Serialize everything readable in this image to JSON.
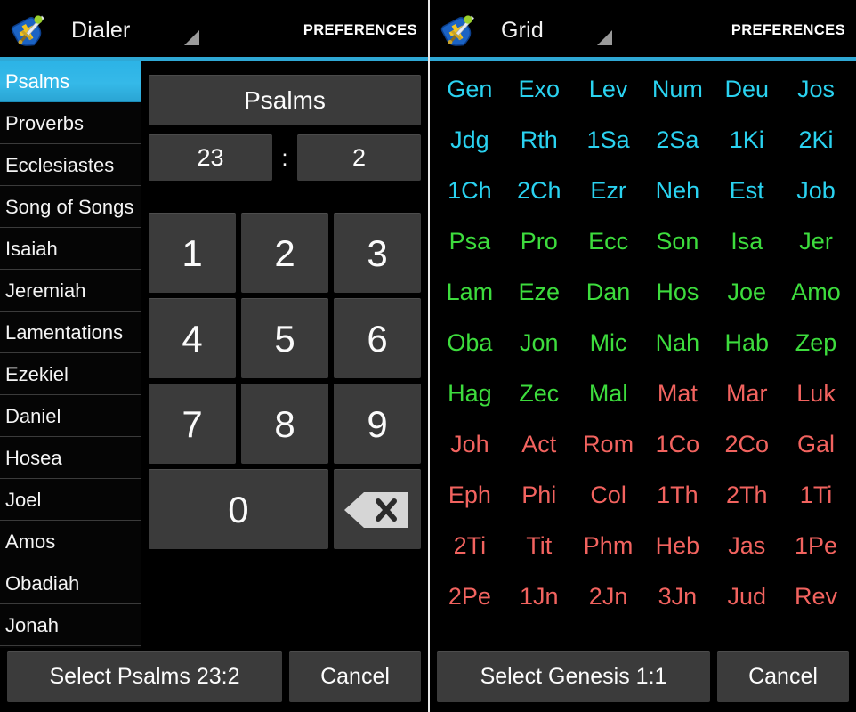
{
  "left": {
    "actionbar": {
      "icon": "shield-sword-app-icon",
      "title": "Dialer",
      "spinner": "dropdown-triangle-icon",
      "preferences": "PREFERENCES"
    },
    "books": [
      {
        "label": "Psalms",
        "selected": true
      },
      {
        "label": "Proverbs",
        "selected": false
      },
      {
        "label": "Ecclesiastes",
        "selected": false
      },
      {
        "label": "Song of Songs",
        "selected": false
      },
      {
        "label": "Isaiah",
        "selected": false
      },
      {
        "label": "Jeremiah",
        "selected": false
      },
      {
        "label": "Lamentations",
        "selected": false
      },
      {
        "label": "Ezekiel",
        "selected": false
      },
      {
        "label": "Daniel",
        "selected": false
      },
      {
        "label": "Hosea",
        "selected": false
      },
      {
        "label": "Joel",
        "selected": false
      },
      {
        "label": "Amos",
        "selected": false
      },
      {
        "label": "Obadiah",
        "selected": false
      },
      {
        "label": "Jonah",
        "selected": false
      }
    ],
    "readout": {
      "book": "Psalms",
      "chapter": "23",
      "separator": ":",
      "verse": "2"
    },
    "keypad": {
      "rows": [
        [
          "1",
          "2",
          "3"
        ],
        [
          "4",
          "5",
          "6"
        ],
        [
          "7",
          "8",
          "9"
        ]
      ],
      "zero": "0",
      "backspace_icon": "backspace-icon"
    },
    "footer": {
      "select": "Select Psalms 23:2",
      "cancel": "Cancel"
    }
  },
  "right": {
    "actionbar": {
      "icon": "shield-sword-app-icon",
      "title": "Grid",
      "spinner": "dropdown-triangle-icon",
      "preferences": "PREFERENCES"
    },
    "grid": {
      "columns": 6,
      "rows": [
        [
          {
            "t": "Gen",
            "c": "#2ad2f0"
          },
          {
            "t": "Exo",
            "c": "#2ad2f0"
          },
          {
            "t": "Lev",
            "c": "#2ad2f0"
          },
          {
            "t": "Num",
            "c": "#2ad2f0"
          },
          {
            "t": "Deu",
            "c": "#2ad2f0"
          },
          {
            "t": "Jos",
            "c": "#2ad2f0"
          }
        ],
        [
          {
            "t": "Jdg",
            "c": "#2ad2f0"
          },
          {
            "t": "Rth",
            "c": "#2ad2f0"
          },
          {
            "t": "1Sa",
            "c": "#2ad2f0"
          },
          {
            "t": "2Sa",
            "c": "#2ad2f0"
          },
          {
            "t": "1Ki",
            "c": "#2ad2f0"
          },
          {
            "t": "2Ki",
            "c": "#2ad2f0"
          }
        ],
        [
          {
            "t": "1Ch",
            "c": "#2ad2f0"
          },
          {
            "t": "2Ch",
            "c": "#2ad2f0"
          },
          {
            "t": "Ezr",
            "c": "#2ad2f0"
          },
          {
            "t": "Neh",
            "c": "#2ad2f0"
          },
          {
            "t": "Est",
            "c": "#2ad2f0"
          },
          {
            "t": "Job",
            "c": "#2ad2f0"
          }
        ],
        [
          {
            "t": "Psa",
            "c": "#3ddc3d"
          },
          {
            "t": "Pro",
            "c": "#3ddc3d"
          },
          {
            "t": "Ecc",
            "c": "#3ddc3d"
          },
          {
            "t": "Son",
            "c": "#3ddc3d"
          },
          {
            "t": "Isa",
            "c": "#3ddc3d"
          },
          {
            "t": "Jer",
            "c": "#3ddc3d"
          }
        ],
        [
          {
            "t": "Lam",
            "c": "#3ddc3d"
          },
          {
            "t": "Eze",
            "c": "#3ddc3d"
          },
          {
            "t": "Dan",
            "c": "#3ddc3d"
          },
          {
            "t": "Hos",
            "c": "#3ddc3d"
          },
          {
            "t": "Joe",
            "c": "#3ddc3d"
          },
          {
            "t": "Amo",
            "c": "#3ddc3d"
          }
        ],
        [
          {
            "t": "Oba",
            "c": "#3ddc3d"
          },
          {
            "t": "Jon",
            "c": "#3ddc3d"
          },
          {
            "t": "Mic",
            "c": "#3ddc3d"
          },
          {
            "t": "Nah",
            "c": "#3ddc3d"
          },
          {
            "t": "Hab",
            "c": "#3ddc3d"
          },
          {
            "t": "Zep",
            "c": "#3ddc3d"
          }
        ],
        [
          {
            "t": "Hag",
            "c": "#3ddc3d"
          },
          {
            "t": "Zec",
            "c": "#3ddc3d"
          },
          {
            "t": "Mal",
            "c": "#3ddc3d"
          },
          {
            "t": "Mat",
            "c": "#f2635f"
          },
          {
            "t": "Mar",
            "c": "#f2635f"
          },
          {
            "t": "Luk",
            "c": "#f2635f"
          }
        ],
        [
          {
            "t": "Joh",
            "c": "#f2635f"
          },
          {
            "t": "Act",
            "c": "#f2635f"
          },
          {
            "t": "Rom",
            "c": "#f2635f"
          },
          {
            "t": "1Co",
            "c": "#f2635f"
          },
          {
            "t": "2Co",
            "c": "#f2635f"
          },
          {
            "t": "Gal",
            "c": "#f2635f"
          }
        ],
        [
          {
            "t": "Eph",
            "c": "#f2635f"
          },
          {
            "t": "Phi",
            "c": "#f2635f"
          },
          {
            "t": "Col",
            "c": "#f2635f"
          },
          {
            "t": "1Th",
            "c": "#f2635f"
          },
          {
            "t": "2Th",
            "c": "#f2635f"
          },
          {
            "t": "1Ti",
            "c": "#f2635f"
          }
        ],
        [
          {
            "t": "2Ti",
            "c": "#f2635f"
          },
          {
            "t": "Tit",
            "c": "#f2635f"
          },
          {
            "t": "Phm",
            "c": "#f2635f"
          },
          {
            "t": "Heb",
            "c": "#f2635f"
          },
          {
            "t": "Jas",
            "c": "#f2635f"
          },
          {
            "t": "1Pe",
            "c": "#f2635f"
          }
        ],
        [
          {
            "t": "2Pe",
            "c": "#f2635f"
          },
          {
            "t": "1Jn",
            "c": "#f2635f"
          },
          {
            "t": "2Jn",
            "c": "#f2635f"
          },
          {
            "t": "3Jn",
            "c": "#f2635f"
          },
          {
            "t": "Jud",
            "c": "#f2635f"
          },
          {
            "t": "Rev",
            "c": "#f2635f"
          }
        ]
      ]
    },
    "footer": {
      "select": "Select Genesis 1:1",
      "cancel": "Cancel"
    }
  },
  "theme": {
    "accent": "#2fa8d5",
    "selected_row": "#33b5e5",
    "button_face": "#3b3b3b",
    "background": "#000000",
    "old_testament_law": "#2ad2f0",
    "old_testament_poetry": "#3ddc3d",
    "new_testament": "#f2635f"
  }
}
